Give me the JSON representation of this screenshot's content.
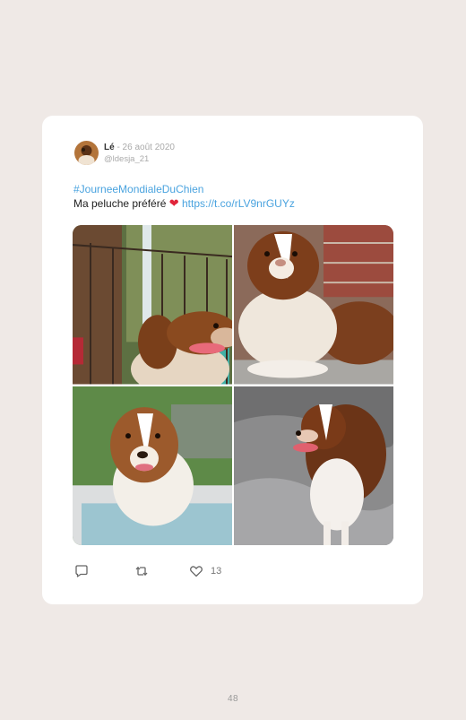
{
  "tweet": {
    "author_name": "Lé",
    "date": "- 26 août 2020",
    "handle": "@ldesja_21",
    "hashtag": "#JourneeMondialeDuChien",
    "text": "Ma peluche préféré",
    "emoji": "❤",
    "link": "https://t.co/rLV9nrGUYz",
    "likes": "13"
  },
  "media": [
    {
      "icon": "dog-photo-waterfall"
    },
    {
      "icon": "dog-photo-lying"
    },
    {
      "icon": "dog-photo-pool"
    },
    {
      "icon": "dog-photo-standing"
    }
  ],
  "page": {
    "number": "48"
  }
}
